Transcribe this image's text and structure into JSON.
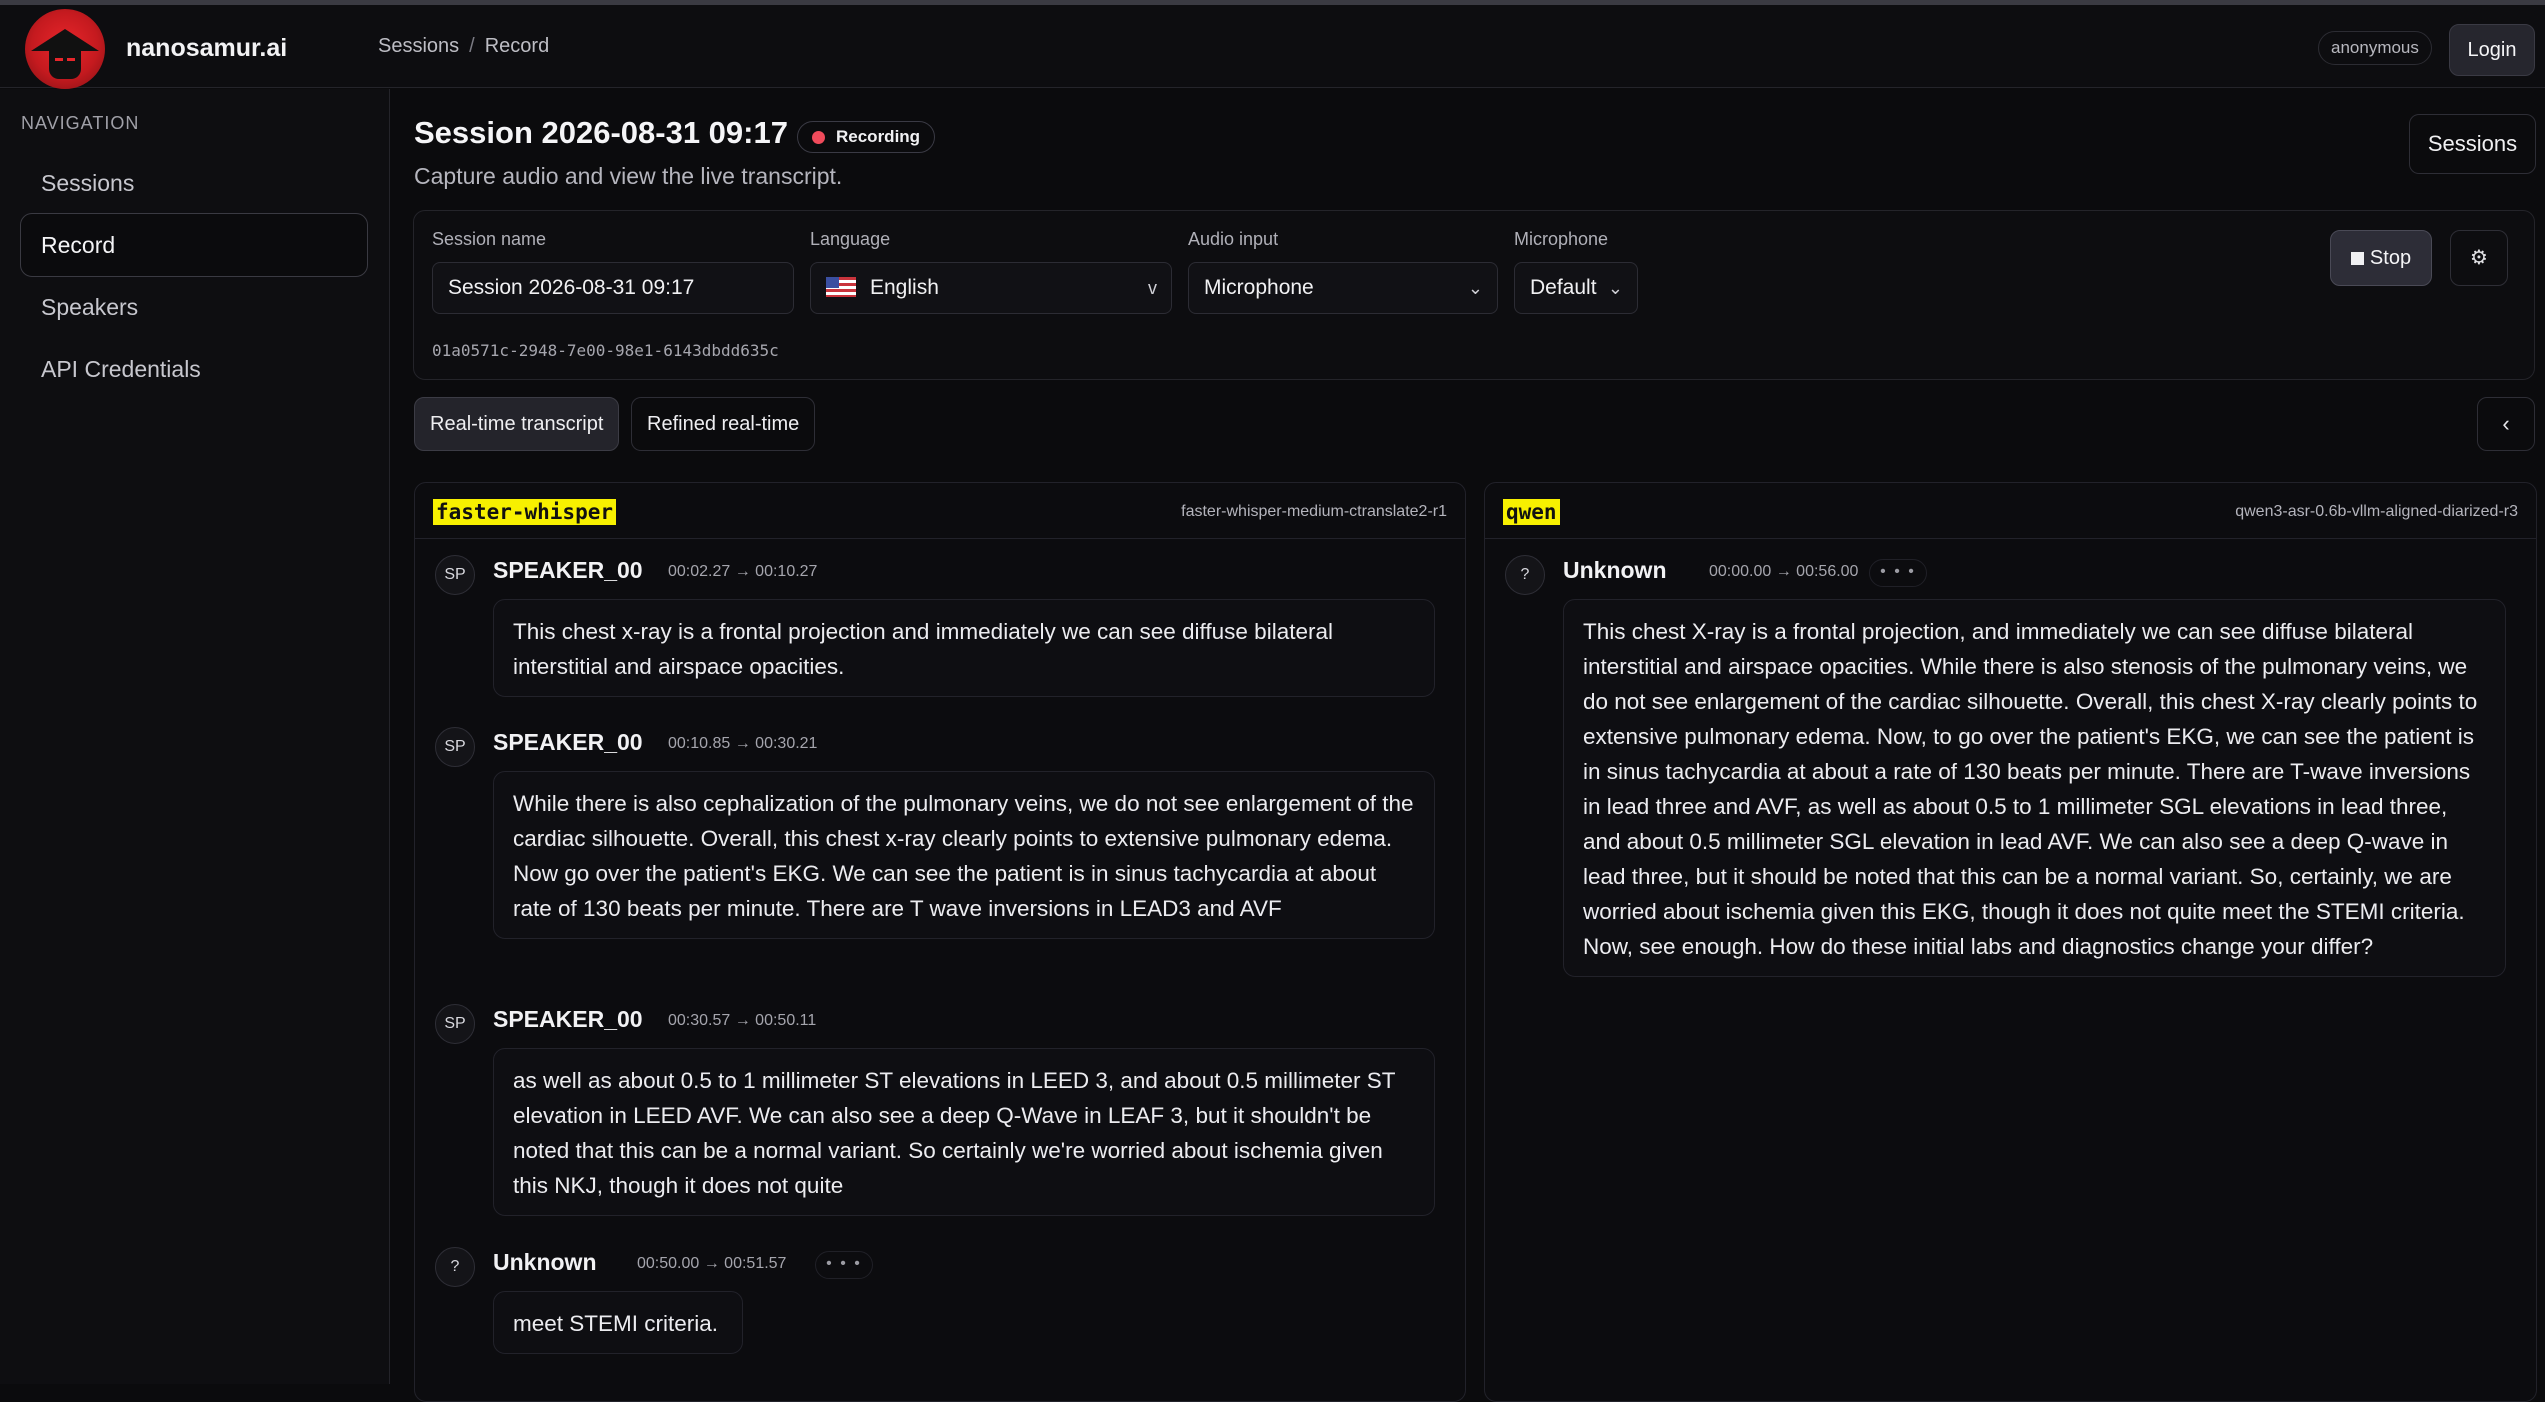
{
  "app": {
    "brand": "nanosamur.ai",
    "breadcrumb": [
      "Sessions",
      "Record"
    ],
    "breadcrumb_sep": "/",
    "user_badge": "anonymous",
    "login_label": "Login"
  },
  "sidebar": {
    "title": "NAVIGATION",
    "items": [
      {
        "label": "Sessions",
        "active": false
      },
      {
        "label": "Record",
        "active": true
      },
      {
        "label": "Speakers",
        "active": false
      },
      {
        "label": "API Credentials",
        "active": false
      }
    ]
  },
  "header": {
    "title": "Session 2026-08-31 09:17",
    "status": "Recording",
    "subtitle": "Capture audio and view the live transcript.",
    "sessions_button": "Sessions"
  },
  "controls": {
    "session_name_label": "Session name",
    "session_name_value": "Session 2026-08-31 09:17",
    "language_label": "Language",
    "language_value": "English",
    "language_chevron": "v",
    "audio_input_label": "Audio input",
    "audio_input_value": "Microphone",
    "microphone_label": "Microphone",
    "microphone_value": "Default",
    "session_id": "01a0571c-2948-7e00-98e1-6143dbdd635c",
    "stop_label": "Stop",
    "gear_glyph": "⚙"
  },
  "tabs": [
    {
      "label": "Real-time transcript",
      "active": true
    },
    {
      "label": "Refined real-time",
      "active": false
    }
  ],
  "collapse_glyph": "‹",
  "panels": [
    {
      "engine": "faster-whisper",
      "model": "faster-whisper-medium-ctranslate2-r1",
      "segments": [
        {
          "avatar": "SP",
          "speaker": "SPEAKER_00",
          "time": "00:02.27 → 00:10.27",
          "text": "This chest x-ray is a frontal projection and immediately we can see diffuse bilateral interstitial and airspace opacities."
        },
        {
          "avatar": "SP",
          "speaker": "SPEAKER_00",
          "time": "00:10.85 → 00:30.21",
          "text": "While there is also cephalization of the pulmonary veins, we do not see enlargement of the cardiac silhouette. Overall, this chest x-ray clearly points to extensive pulmonary edema. Now go over the patient's EKG. We can see the patient is in sinus tachycardia at about rate of 130 beats per minute. There are T wave inversions in LEAD3 and AVF"
        },
        {
          "avatar": "SP",
          "speaker": "SPEAKER_00",
          "time": "00:30.57 → 00:50.11",
          "text": "as well as about 0.5 to 1 millimeter ST elevations in LEED 3, and about 0.5 millimeter ST elevation in LEED AVF. We can also see a deep Q-Wave in LEAF 3, but it shouldn't be noted that this can be a normal variant. So certainly we're worried about ischemia given this NKJ, though it does not quite"
        },
        {
          "avatar": "?",
          "speaker": "Unknown",
          "time": "00:50.00 → 00:51.57",
          "more": "• • •",
          "text": "meet STEMI criteria."
        }
      ]
    },
    {
      "engine": "qwen",
      "model": "qwen3-asr-0.6b-vllm-aligned-diarized-r3",
      "segments": [
        {
          "avatar": "?",
          "speaker": "Unknown",
          "time": "00:00.00 → 00:56.00",
          "more": "• • •",
          "text": "This chest X-ray is a frontal projection, and immediately we can see diffuse bilateral interstitial and airspace opacities. While there is also stenosis of the pulmonary veins, we do not see enlargement of the cardiac silhouette. Overall, this chest X-ray clearly points to extensive pulmonary edema. Now, to go over the patient's EKG, we can see the patient is in sinus tachycardia at about a rate of 130 beats per minute. There are T-wave inversions in lead three and AVF, as well as about 0.5 to 1 millimeter SGL elevations in lead three, and about 0.5 millimeter SGL elevation in lead AVF. We can also see a deep Q-wave in lead three, but it should be noted that this can be a normal variant. So, certainly, we are worried about ischemia given this EKG, though it does not quite meet the STEMI criteria. Now, see enough. How do these initial labs and diagnostics change your differ?"
        }
      ]
    }
  ],
  "colors": {
    "accent_recording": "#f04b5b",
    "engine_highlight": "#f7f000",
    "background": "#0b0b0d"
  }
}
